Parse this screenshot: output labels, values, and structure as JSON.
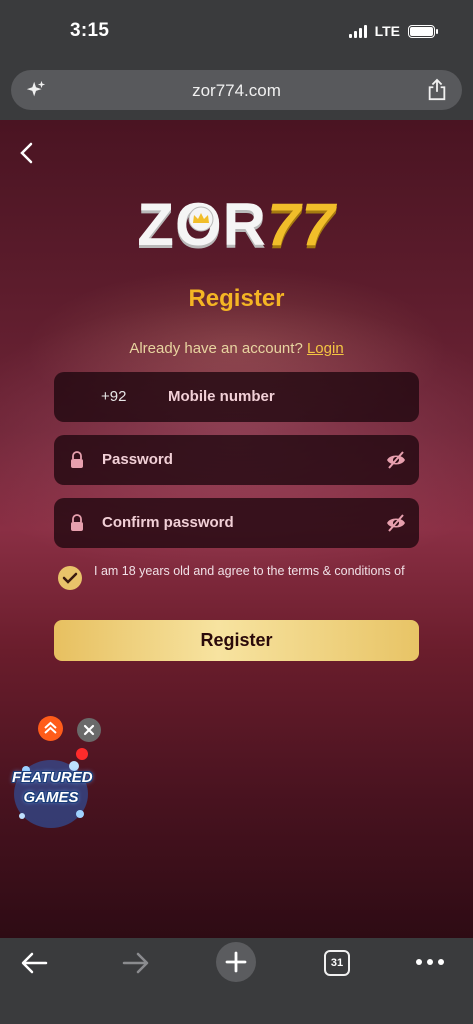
{
  "status_bar": {
    "time": "3:15",
    "network": "LTE",
    "battery_level": 1.0
  },
  "browser": {
    "url": "zor774.com",
    "tab_count": "31"
  },
  "page": {
    "logo_left": "ZOR",
    "logo_right": "77",
    "title": "Register",
    "login_prompt": "Already have an account?",
    "login_link": "Login",
    "mobile": {
      "prefix": "+92",
      "placeholder": "Mobile number"
    },
    "password_placeholder": "Password",
    "confirm_placeholder": "Confirm password",
    "terms_text": "I am 18 years old and agree to the terms & conditions of",
    "terms_checked": true,
    "register_button": "Register"
  },
  "widget": {
    "label_line1": "FEATURED",
    "label_line2": "GAMES"
  },
  "colors": {
    "accent_gold": "#f4b524",
    "widget_orange": "#ff5c1a",
    "notification_red": "#ff2b2b"
  }
}
